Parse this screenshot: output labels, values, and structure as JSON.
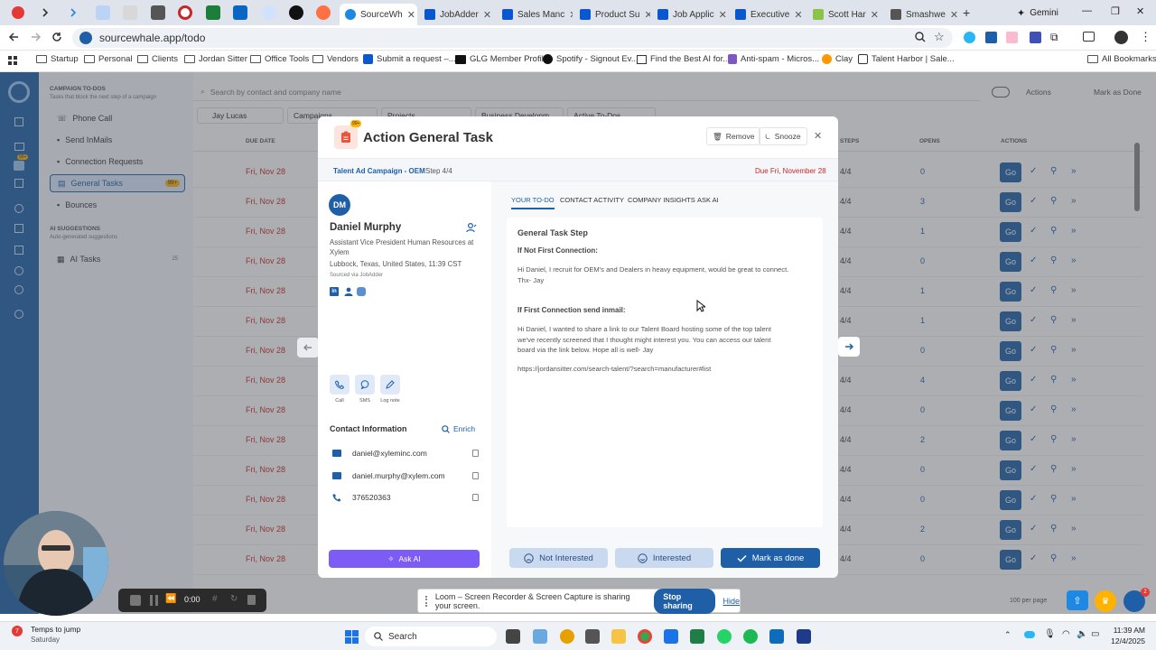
{
  "browser": {
    "tabs": [
      {
        "label": "SourceWh",
        "color": "#1e88e5"
      },
      {
        "label": "JobAdder",
        "color": "#0b57d0"
      },
      {
        "label": "Sales Manc",
        "color": "#0b57d0"
      },
      {
        "label": "Product Su",
        "color": "#0b57d0"
      },
      {
        "label": "Job Applic",
        "color": "#0b57d0"
      },
      {
        "label": "Executive",
        "color": "#0b57d0"
      },
      {
        "label": "Scott Har",
        "color": "#8bc34a"
      },
      {
        "label": "Smashwe",
        "color": "#555555"
      }
    ],
    "gemini_label": "Gemini",
    "url": "sourcewhale.app/todo",
    "bookmarks": [
      {
        "label": "Startup",
        "icon": "folder-icon"
      },
      {
        "label": "Personal",
        "icon": "folder-icon"
      },
      {
        "label": "Clients",
        "icon": "folder-icon"
      },
      {
        "label": "Jordan Sitter",
        "icon": "folder-icon"
      },
      {
        "label": "Office Tools",
        "icon": "folder-icon"
      },
      {
        "label": "Vendors",
        "icon": "folder-icon"
      },
      {
        "label": "Submit a request –...",
        "icon": "jira-icon"
      },
      {
        "label": "GLG Member Profile",
        "icon": "glg-icon"
      },
      {
        "label": "Spotify - Signout Ev...",
        "icon": "spotify-icon"
      },
      {
        "label": "Find the Best AI for...",
        "icon": "ai-icon"
      },
      {
        "label": "Anti-spam - Micros...",
        "icon": "shield-icon"
      },
      {
        "label": "Clay",
        "icon": "clay-icon"
      },
      {
        "label": "Talent Harbor | Sale...",
        "icon": "harbor-icon"
      }
    ],
    "all_bookmarks": "All Bookmarks"
  },
  "app": {
    "sidebar_header": "CAMPAIGN TO-DOS",
    "sidebar_sub": "Tasks that block the next step of a campaign",
    "sidebar_items": [
      {
        "label": "Phone Call",
        "badge": ""
      },
      {
        "label": "Send InMails",
        "badge": ""
      },
      {
        "label": "Connection Requests",
        "badge": ""
      },
      {
        "label": "General Tasks",
        "badge": "99+"
      },
      {
        "label": "Bounces",
        "badge": ""
      }
    ],
    "ai_header": "AI SUGGESTIONS",
    "ai_sub": "Auto-generated suggestions",
    "ai_item": {
      "label": "AI Tasks",
      "badge": "25"
    },
    "search_placeholder": "Search by contact and company name",
    "actions_label": "Actions",
    "mark_done_label": "Mark as Done",
    "filters": [
      "Jay Lucas",
      "Campaigns",
      "Projects",
      "Business Developm",
      "Active To-Dos"
    ],
    "col_due": "DUE DATE",
    "col_steps": "STEPS",
    "col_opens": "OPENS",
    "col_actions": "ACTIONS",
    "rows": [
      {
        "date": "Fri, Nov 28",
        "steps": "4/4",
        "opens": "0"
      },
      {
        "date": "Fri, Nov 28",
        "steps": "4/4",
        "opens": "3"
      },
      {
        "date": "Fri, Nov 28",
        "steps": "4/4",
        "opens": "1"
      },
      {
        "date": "Fri, Nov 28",
        "steps": "4/4",
        "opens": "0"
      },
      {
        "date": "Fri, Nov 28",
        "steps": "4/4",
        "opens": "1"
      },
      {
        "date": "Fri, Nov 28",
        "steps": "4/4",
        "opens": "1"
      },
      {
        "date": "Fri, Nov 28",
        "steps": "4/4",
        "opens": "0"
      },
      {
        "date": "Fri, Nov 28",
        "steps": "4/4",
        "opens": "4"
      },
      {
        "date": "Fri, Nov 28",
        "steps": "4/4",
        "opens": "0"
      },
      {
        "date": "Fri, Nov 28",
        "steps": "4/4",
        "opens": "2"
      },
      {
        "date": "Fri, Nov 28",
        "steps": "4/4",
        "opens": "0"
      },
      {
        "date": "Fri, Nov 28",
        "steps": "4/4",
        "opens": "0"
      },
      {
        "date": "Fri, Nov 28",
        "steps": "4/4",
        "opens": "2"
      },
      {
        "date": "Fri, Nov 28",
        "steps": "4/4",
        "opens": "0"
      }
    ],
    "go_label": "Go",
    "per_page": "100 per page"
  },
  "modal": {
    "badge": "99+",
    "title": "Action General Task",
    "remove_label": "Remove",
    "snooze_label": "Snooze",
    "campaign": "Talent Ad Campaign - OEM",
    "step": "Step 4/4",
    "due": "Due Fri, November 28",
    "contact": {
      "initials": "DM",
      "name": "Daniel Murphy",
      "title": "Assistant Vice President Human Resources at Xylem",
      "location": "Lubbock, Texas, United States, 11:39 CST",
      "source": "Sourced via JobAdder",
      "call_label": "Call",
      "sms_label": "SMS",
      "lognote_label": "Log note",
      "info_header": "Contact Information",
      "enrich_label": "Enrich",
      "email1": "daniel@xyleminc.com",
      "email2": "daniel.murphy@xylem.com",
      "phone": "376520363"
    },
    "tabs": [
      "YOUR TO-DO",
      "CONTACT ACTIVITY",
      "COMPANY INSIGHTS",
      "ASK AI"
    ],
    "step_title": "General Task Step",
    "label1": "If Not First Connection:",
    "msg1": "Hi Daniel, I recruit for OEM's and Dealers in heavy equipment, would be great to connect.\nThx- Jay",
    "label2": "If First Connection send inmail:",
    "msg2": "Hi Daniel, I wanted to share a link to our Talent Board hosting some of the top talent\nwe've recently screened that I thought might interest you.  You can access our talent\nboard via the link below.  Hope all is well- Jay",
    "link": "https://jordansitter.com/search-talent/?search=manufacturer#list",
    "ask_ai_label": "Ask AI",
    "not_interested_label": "Not Interested",
    "interested_label": "Interested",
    "mark_done_label": "Mark as done"
  },
  "loom": {
    "message": "Loom – Screen Recorder & Screen Capture is sharing your screen.",
    "stop_label": "Stop sharing",
    "hide_label": "Hide"
  },
  "recorder": {
    "time": "0:00"
  },
  "taskbar": {
    "weather_badge": "7",
    "weather_title": "Temps to jump",
    "weather_sub": "Saturday",
    "search_label": "Search",
    "time": "11:39 AM",
    "date": "12/4/2025",
    "notif_badge": "2"
  }
}
